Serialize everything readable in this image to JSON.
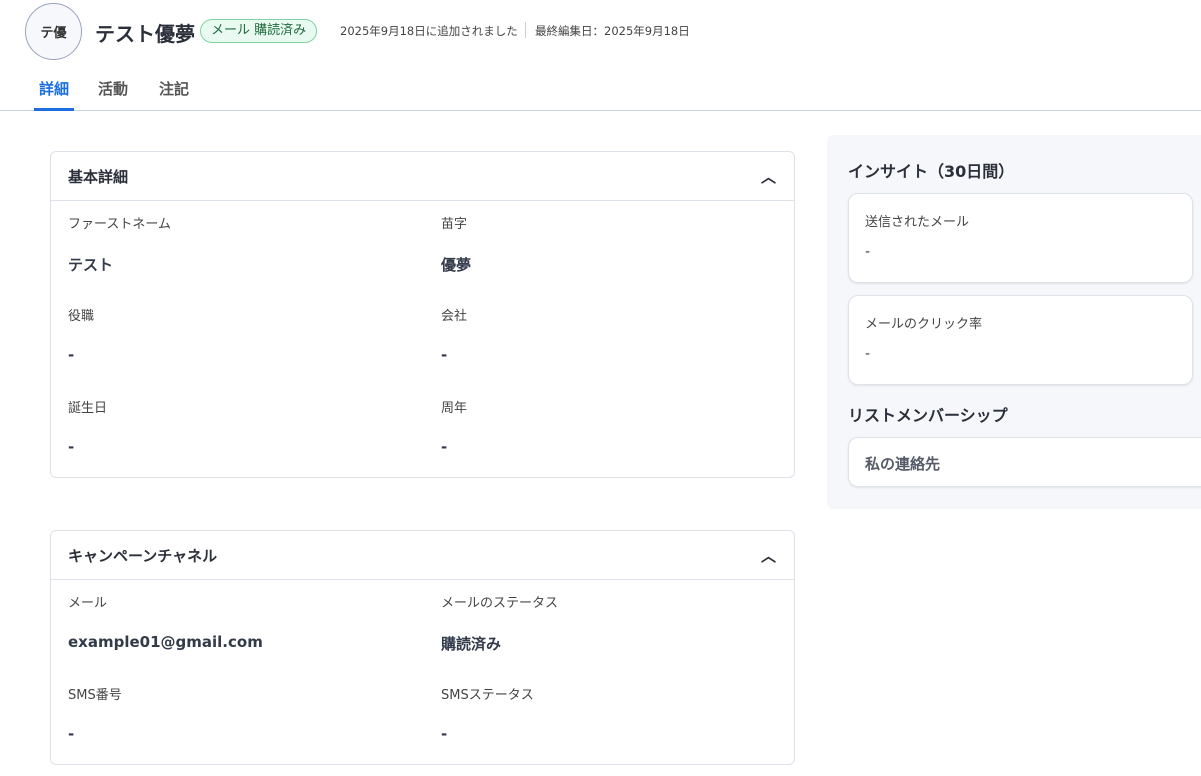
{
  "header": {
    "avatar_initials": "テ優",
    "name": "テスト優夢",
    "badge": "メール 購読済み",
    "added": "2025年9月18日に追加されました",
    "edited": "最終編集日：2025年9月18日"
  },
  "tabs": [
    {
      "label": "詳細"
    },
    {
      "label": "活動"
    },
    {
      "label": "注記"
    }
  ],
  "basic": {
    "title": "基本詳細",
    "fields": [
      {
        "label": "ファーストネーム",
        "value": "テスト"
      },
      {
        "label": "苗字",
        "value": "優夢"
      },
      {
        "label": "役職",
        "value": "-"
      },
      {
        "label": "会社",
        "value": "-"
      },
      {
        "label": "誕生日",
        "value": "-"
      },
      {
        "label": "周年",
        "value": "-"
      }
    ]
  },
  "campaign": {
    "title": "キャンペーンチャネル",
    "fields": [
      {
        "label": "メール",
        "value": "example01@gmail.com"
      },
      {
        "label": "メールのステータス",
        "value": "購読済み"
      },
      {
        "label": "SMS番号",
        "value": "-"
      },
      {
        "label": "SMSステータス",
        "value": "-"
      }
    ]
  },
  "insights": {
    "title": "インサイト（30日間）",
    "cards": [
      {
        "label": "送信されたメール",
        "value": "-"
      },
      {
        "label": "メールのクリック率",
        "value": "-"
      }
    ]
  },
  "lists": {
    "title": "リストメンバーシップ",
    "items": [
      "私の連絡先"
    ]
  }
}
